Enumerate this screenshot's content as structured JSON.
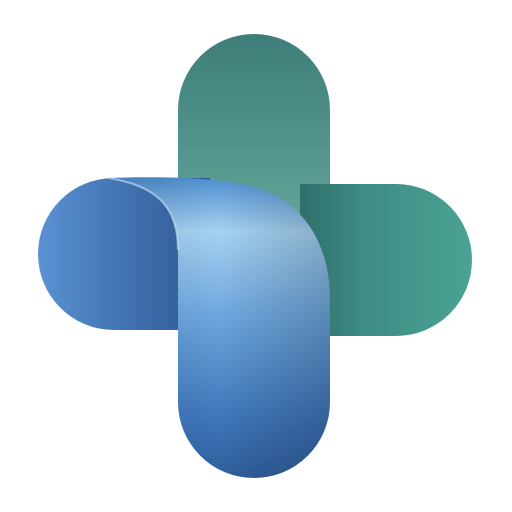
{
  "image": {
    "kind": "app-icon",
    "icon": "ribbon-medical-cross-icon",
    "background_color": "#ffffff"
  },
  "colors": {
    "teal_dark": "#3f7f7a",
    "teal_mid": "#4a9f93",
    "teal_light": "#7ebfb0",
    "blue_dark": "#2f5f98",
    "blue_mid": "#4b86c9",
    "blue_light": "#9fcaf0"
  }
}
